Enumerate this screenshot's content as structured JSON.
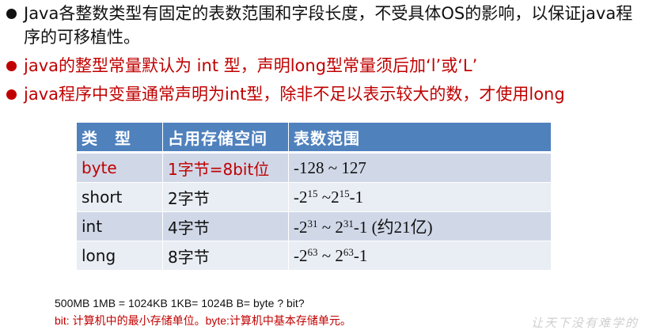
{
  "bullets": [
    "Java各整数类型有固定的表数范围和字段长度，不受具体OS的影响，以保证java程序的可移植性。",
    "java的整型常量默认为 int 型，声明long型常量须后加‘l’或‘L’",
    "java程序中变量通常声明为int型，除非不足以表示较大的数，才使用long"
  ],
  "table": {
    "headers": [
      "类　型",
      "占用存储空间",
      "表数范围"
    ],
    "rows": [
      {
        "type": "byte",
        "size": "1字节=8bit位",
        "range": {
          "pre": "-128 ~ 127"
        }
      },
      {
        "type": "short",
        "size": "2字节",
        "range": {
          "pre": "-2",
          "exp1": "15",
          "mid": " ~2",
          "exp2": "15",
          "post": "-1"
        }
      },
      {
        "type": "int",
        "size": "4字节",
        "range": {
          "pre": "-2",
          "exp1": "31",
          "mid": " ~ 2",
          "exp2": "31",
          "post": "-1 (约21亿)"
        }
      },
      {
        "type": "long",
        "size": "8字节",
        "range": {
          "pre": "-2",
          "exp1": "63",
          "mid": " ~ 2",
          "exp2": "63",
          "post": "-1"
        }
      }
    ]
  },
  "notes": {
    "line1": "500MB   1MB = 1024KB  1KB= 1024B  B= byte ? bit?",
    "line2": "bit: 计算机中的最小存储单位。byte:计算机中基本存储单元。"
  },
  "watermark": "让天下没有难学的"
}
